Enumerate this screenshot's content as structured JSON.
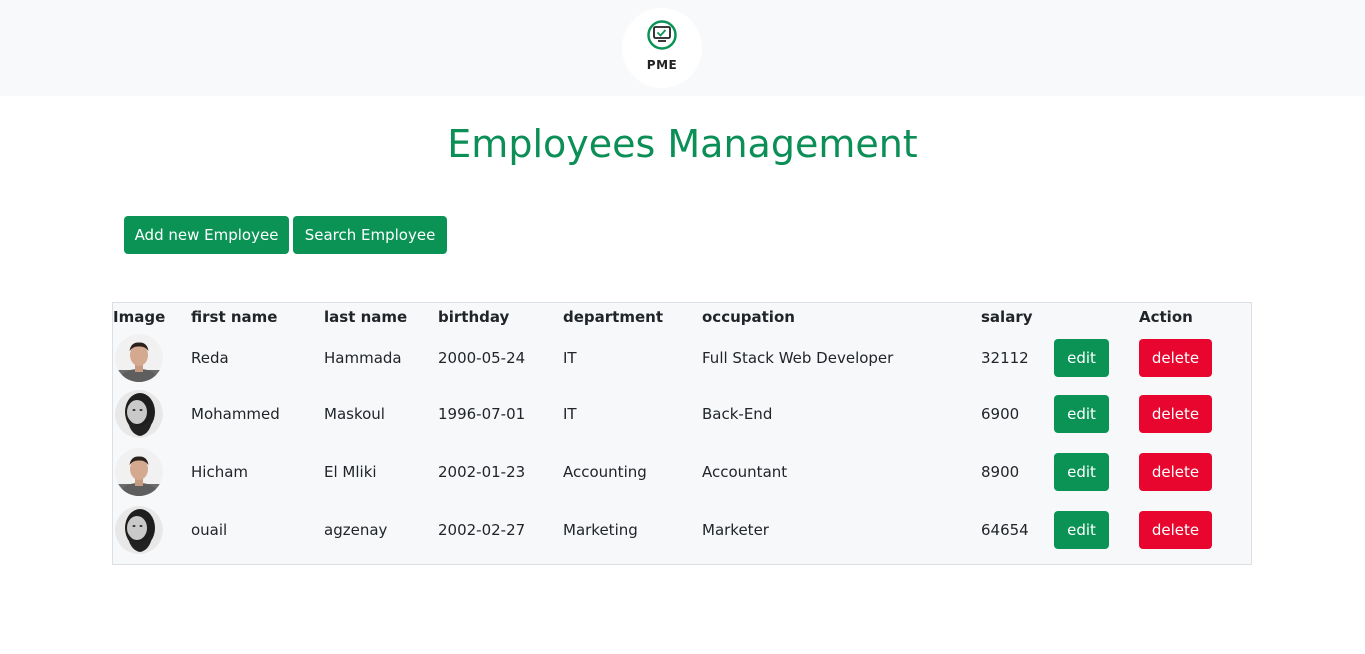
{
  "header": {
    "logo_text": "PME",
    "logo_icon": "monitor-check-icon"
  },
  "page": {
    "title": "Employees Management"
  },
  "toolbar": {
    "add_label": "Add new Employee",
    "search_label": "Search Employee"
  },
  "table": {
    "columns": {
      "image": "Image",
      "first_name": "first name",
      "last_name": "last name",
      "birthday": "birthday",
      "department": "department",
      "occupation": "occupation",
      "salary": "salary",
      "edit": "",
      "action": "Action"
    },
    "rows": [
      {
        "avatar": "avatar-young-man",
        "first_name": "Reda",
        "last_name": "Hammada",
        "birthday": "2000-05-24",
        "department": "IT",
        "occupation": "Full Stack Web Developer",
        "salary": "32112",
        "edit_label": "edit",
        "delete_label": "delete"
      },
      {
        "avatar": "avatar-bearded-man",
        "first_name": "Mohammed",
        "last_name": "Maskoul",
        "birthday": "1996-07-01",
        "department": "IT",
        "occupation": "Back-End",
        "salary": "6900",
        "edit_label": "edit",
        "delete_label": "delete"
      },
      {
        "avatar": "avatar-young-man",
        "first_name": "Hicham",
        "last_name": "El Mliki",
        "birthday": "2002-01-23",
        "department": "Accounting",
        "occupation": "Accountant",
        "salary": "8900",
        "edit_label": "edit",
        "delete_label": "delete"
      },
      {
        "avatar": "avatar-bearded-man",
        "first_name": "ouail",
        "last_name": "agzenay",
        "birthday": "2002-02-27",
        "department": "Marketing",
        "occupation": "Marketer",
        "salary": "64654",
        "edit_label": "edit",
        "delete_label": "delete"
      }
    ]
  },
  "colors": {
    "accent": "#0b9356",
    "danger": "#e8052e",
    "header_bg": "#f8f9fa"
  }
}
